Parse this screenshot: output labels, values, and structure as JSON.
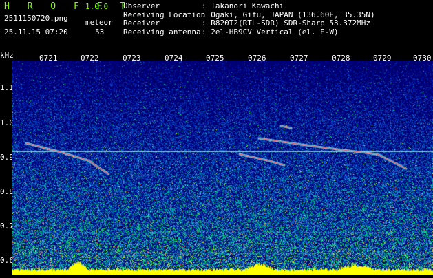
{
  "header": {
    "logo": "H R O F F T",
    "version": "1.0.0",
    "filename": "2511150720.png",
    "meteor_label": "meteor",
    "datetime": "25.11.15 07:20",
    "meteor_count": "53"
  },
  "info": [
    {
      "key": "Observer",
      "value": ": Takanori Kawachi"
    },
    {
      "key": "Receiving Location",
      "value": ": Ogaki, Gifu, JAPAN (136.60E, 35.35N)"
    },
    {
      "key": "Receiver",
      "value": ": R820T2(RTL-SDR) SDR-Sharp 53.372MHz"
    },
    {
      "key": "Receiving antenna",
      "value": ": 2el-HB9CV Vertical (el. E-W)"
    }
  ],
  "axes": {
    "y_unit": "kHz",
    "y_ticks": [
      "1.1",
      "1.0",
      "0.9",
      "0.8",
      "0.7",
      "0.6"
    ],
    "x_ticks": [
      "0721",
      "0722",
      "0723",
      "0724",
      "0725",
      "0726",
      "0727",
      "0728",
      "0729",
      "0730"
    ]
  },
  "colors": {
    "background": "#000000",
    "plot_base": "#00007a",
    "logo": "#7fff00",
    "carrier": "#9fe8ff",
    "meteor_trail": "#ff4040",
    "baseline": "#ffff00"
  }
}
